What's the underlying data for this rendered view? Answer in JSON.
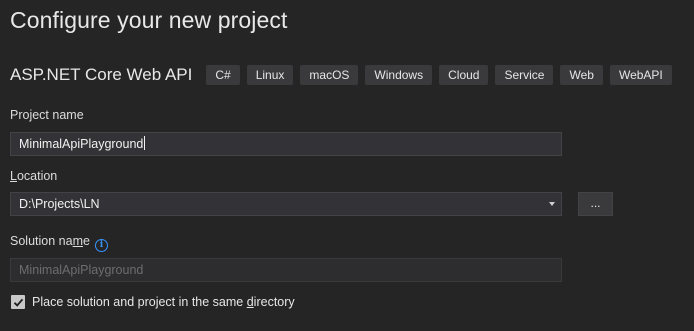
{
  "page": {
    "title": "Configure your new project"
  },
  "template": {
    "name": "ASP.NET Core Web API",
    "tags": [
      "C#",
      "Linux",
      "macOS",
      "Windows",
      "Cloud",
      "Service",
      "Web",
      "WebAPI"
    ]
  },
  "project_name": {
    "label": "Project name",
    "value": "MinimalApiPlayground"
  },
  "location": {
    "label_prefix": "L",
    "label_rest": "ocation",
    "value": "D:\\Projects\\LN",
    "browse_label": "..."
  },
  "solution_name": {
    "label_prefix": "Solution na",
    "label_underlined": "m",
    "label_suffix": "e",
    "info_icon_glyph": "i",
    "value": "MinimalApiPlayground"
  },
  "same_directory": {
    "label_prefix": "Place solution and project in the same ",
    "label_underlined": "d",
    "label_suffix": "irectory",
    "checked": true
  },
  "colors": {
    "background": "#252526",
    "accent": "#3794ff",
    "field_bg": "#333337",
    "tag_bg": "#3a3a3c"
  }
}
